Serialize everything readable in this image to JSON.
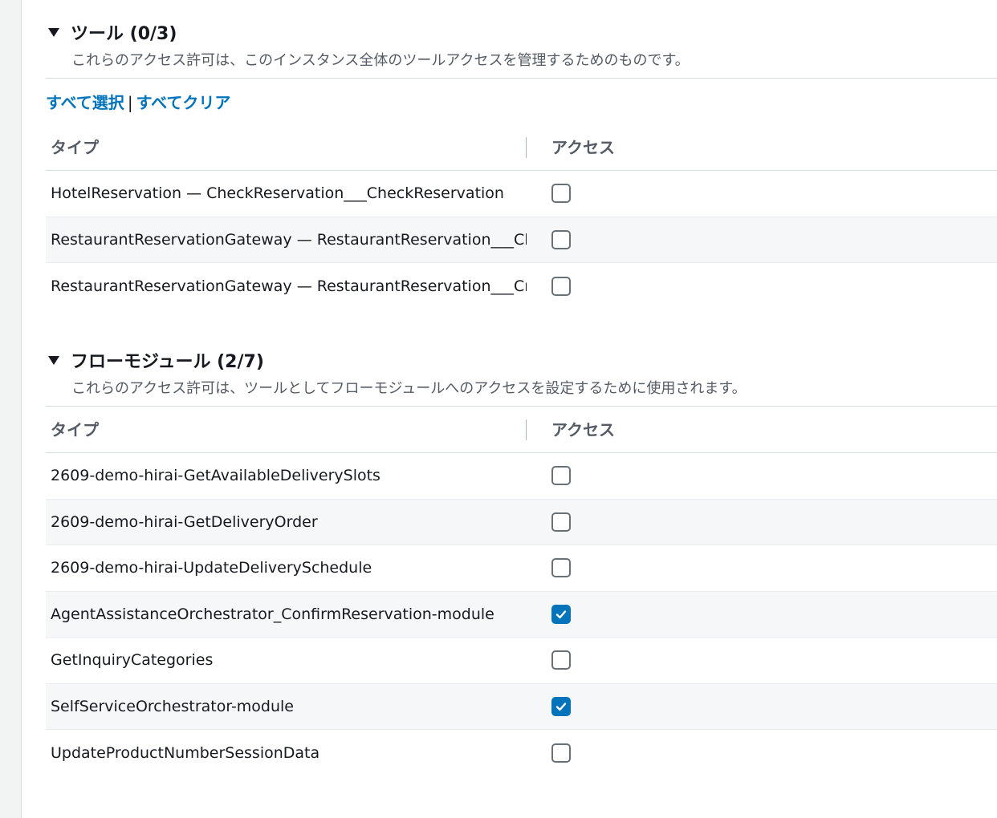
{
  "tools_section": {
    "title": "ツール (0/3)",
    "description": "これらのアクセス許可は、このインスタンス全体のツールアクセスを管理するためのものです。",
    "select_all": "すべて選択",
    "separator": "|",
    "clear_all": "すべてクリア",
    "columns": {
      "type": "タイプ",
      "access": "アクセス"
    },
    "rows": [
      {
        "name": "HotelReservation — CheckReservation___CheckReservation",
        "checked": false
      },
      {
        "name": "RestaurantReservationGateway — RestaurantReservation___Cl",
        "checked": false
      },
      {
        "name": "RestaurantReservationGateway — RestaurantReservation___Cr",
        "checked": false
      }
    ]
  },
  "flow_section": {
    "title": "フローモジュール (2/7)",
    "description": "これらのアクセス許可は、ツールとしてフローモジュールへのアクセスを設定するために使用されます。",
    "columns": {
      "type": "タイプ",
      "access": "アクセス"
    },
    "rows": [
      {
        "name": "2609-demo-hirai-GetAvailableDeliverySlots",
        "checked": false
      },
      {
        "name": "2609-demo-hirai-GetDeliveryOrder",
        "checked": false
      },
      {
        "name": "2609-demo-hirai-UpdateDeliverySchedule",
        "checked": false
      },
      {
        "name": "AgentAssistanceOrchestrator_ConfirmReservation-module",
        "checked": true
      },
      {
        "name": "GetInquiryCategories",
        "checked": false
      },
      {
        "name": "SelfServiceOrchestrator-module",
        "checked": true
      },
      {
        "name": "UpdateProductNumberSessionData",
        "checked": false
      }
    ]
  },
  "colors": {
    "accent": "#0073bb",
    "checkbox_border": "#687078",
    "alt_row": "#f6f7f8"
  }
}
